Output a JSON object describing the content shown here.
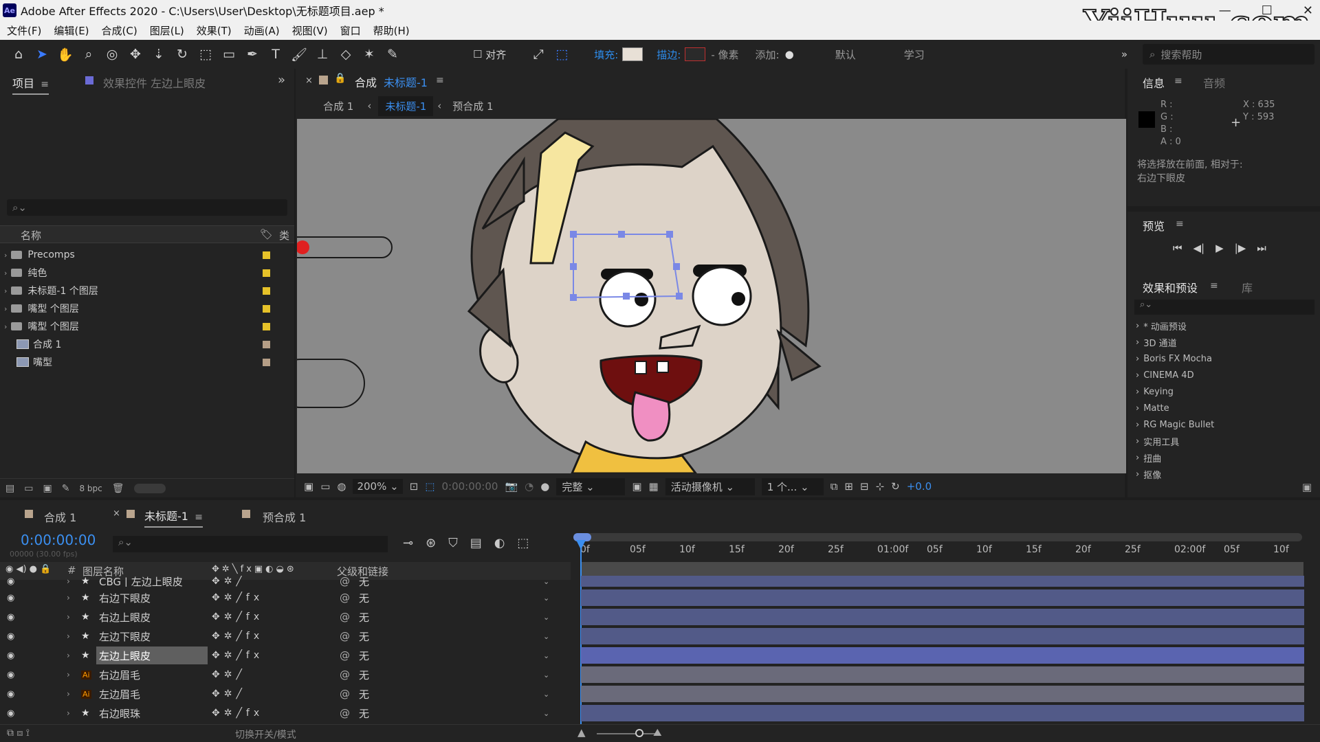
{
  "window": {
    "title": "Adobe After Effects 2020 - C:\\Users\\User\\Desktop\\无标题项目.aep *",
    "app_icon": "Ae",
    "controls": [
      "—",
      "☐",
      "✕"
    ],
    "watermark": "YiiHuu.com"
  },
  "menu": [
    "文件(F)",
    "编辑(E)",
    "合成(C)",
    "图层(L)",
    "效果(T)",
    "动画(A)",
    "视图(V)",
    "窗口",
    "帮助(H)"
  ],
  "toolbar": {
    "align_label": "对齐",
    "fill_label": "填充:",
    "stroke_label": "描边:",
    "pixels_label": "- 像素",
    "add_label": "添加:",
    "workspace_default": "默认",
    "workspace_learn": "学习",
    "search_placeholder": "搜索帮助",
    "colors": {
      "fill": "#e8e0d6",
      "stroke": "#c03030"
    }
  },
  "project_panel": {
    "tab_project": "项目",
    "tab_effects": "效果控件 左边上眼皮",
    "col_name": "名称",
    "col_type": "类",
    "items": [
      {
        "name": "Precomps",
        "kind": "folder",
        "color": "#e6c229"
      },
      {
        "name": "纯色",
        "kind": "folder",
        "color": "#e6c229"
      },
      {
        "name": "未标题-1 个图层",
        "kind": "folder",
        "color": "#e6c229"
      },
      {
        "name": "嘴型 个图层",
        "kind": "folder",
        "color": "#e6c229"
      },
      {
        "name": "嘴型 个图层",
        "kind": "folder",
        "color": "#e6c229"
      },
      {
        "name": "合成 1",
        "kind": "comp",
        "color": "#b59e86"
      },
      {
        "name": "嘴型",
        "kind": "comp",
        "color": "#b59e86"
      }
    ],
    "bpc": "8 bpc"
  },
  "viewer": {
    "tab_prefix": "合成",
    "tab_name": "未标题-1",
    "crumbs": [
      "合成 1",
      "未标题-1",
      "预合成 1"
    ],
    "zoom": "200%",
    "timecode": "0:00:00:00",
    "resolution": "完整",
    "camera": "活动摄像机",
    "views": "1 个...",
    "exposure": "+0.0"
  },
  "info_panel": {
    "tab_info": "信息",
    "tab_audio": "音频",
    "r": "R :",
    "g": "G :",
    "b": "B :",
    "a": "A : 0",
    "x": "X : 635",
    "y": "Y : 593",
    "message_line1": "将选择放在前面, 相对于:",
    "message_line2": "右边下眼皮"
  },
  "preview_panel": {
    "title": "预览"
  },
  "effects_panel": {
    "tab_effects": "效果和预设",
    "tab_library": "库",
    "items": [
      "* 动画预设",
      "3D 通道",
      "Boris FX Mocha",
      "CINEMA 4D",
      "Keying",
      "Matte",
      "RG Magic Bullet",
      "实用工具",
      "扭曲",
      "抠像"
    ]
  },
  "timeline": {
    "tabs": [
      "合成 1",
      "未标题-1",
      "预合成 1"
    ],
    "timecode": "0:00:00:00",
    "frame_info": "00000 (30.00 fps)",
    "col_layer_name": "图层名称",
    "col_parent": "父级和链接",
    "ruler": [
      "0f",
      "05f",
      "10f",
      "15f",
      "20f",
      "25f",
      "01:00f",
      "05f",
      "10f",
      "15f",
      "20f",
      "25f",
      "02:00f",
      "05f",
      "10f"
    ],
    "layers": [
      {
        "name": "CBG | 左边上眼皮",
        "type": "star",
        "fx": false,
        "parent": "无",
        "style": "shape"
      },
      {
        "name": "右边下眼皮",
        "type": "star",
        "fx": true,
        "parent": "无",
        "style": "shape"
      },
      {
        "name": "右边上眼皮",
        "type": "star",
        "fx": true,
        "parent": "无",
        "style": "shape"
      },
      {
        "name": "左边下眼皮",
        "type": "star",
        "fx": true,
        "parent": "无",
        "style": "shape"
      },
      {
        "name": "左边上眼皮",
        "type": "star",
        "fx": true,
        "parent": "无",
        "style": "selected"
      },
      {
        "name": "右边眉毛",
        "type": "ai",
        "fx": false,
        "parent": "无",
        "style": "ai"
      },
      {
        "name": "左边眉毛",
        "type": "ai",
        "fx": false,
        "parent": "无",
        "style": "ai"
      },
      {
        "name": "右边眼珠",
        "type": "star",
        "fx": true,
        "parent": "无",
        "style": "shape"
      }
    ],
    "footer_toggle": "切换开关/模式"
  }
}
